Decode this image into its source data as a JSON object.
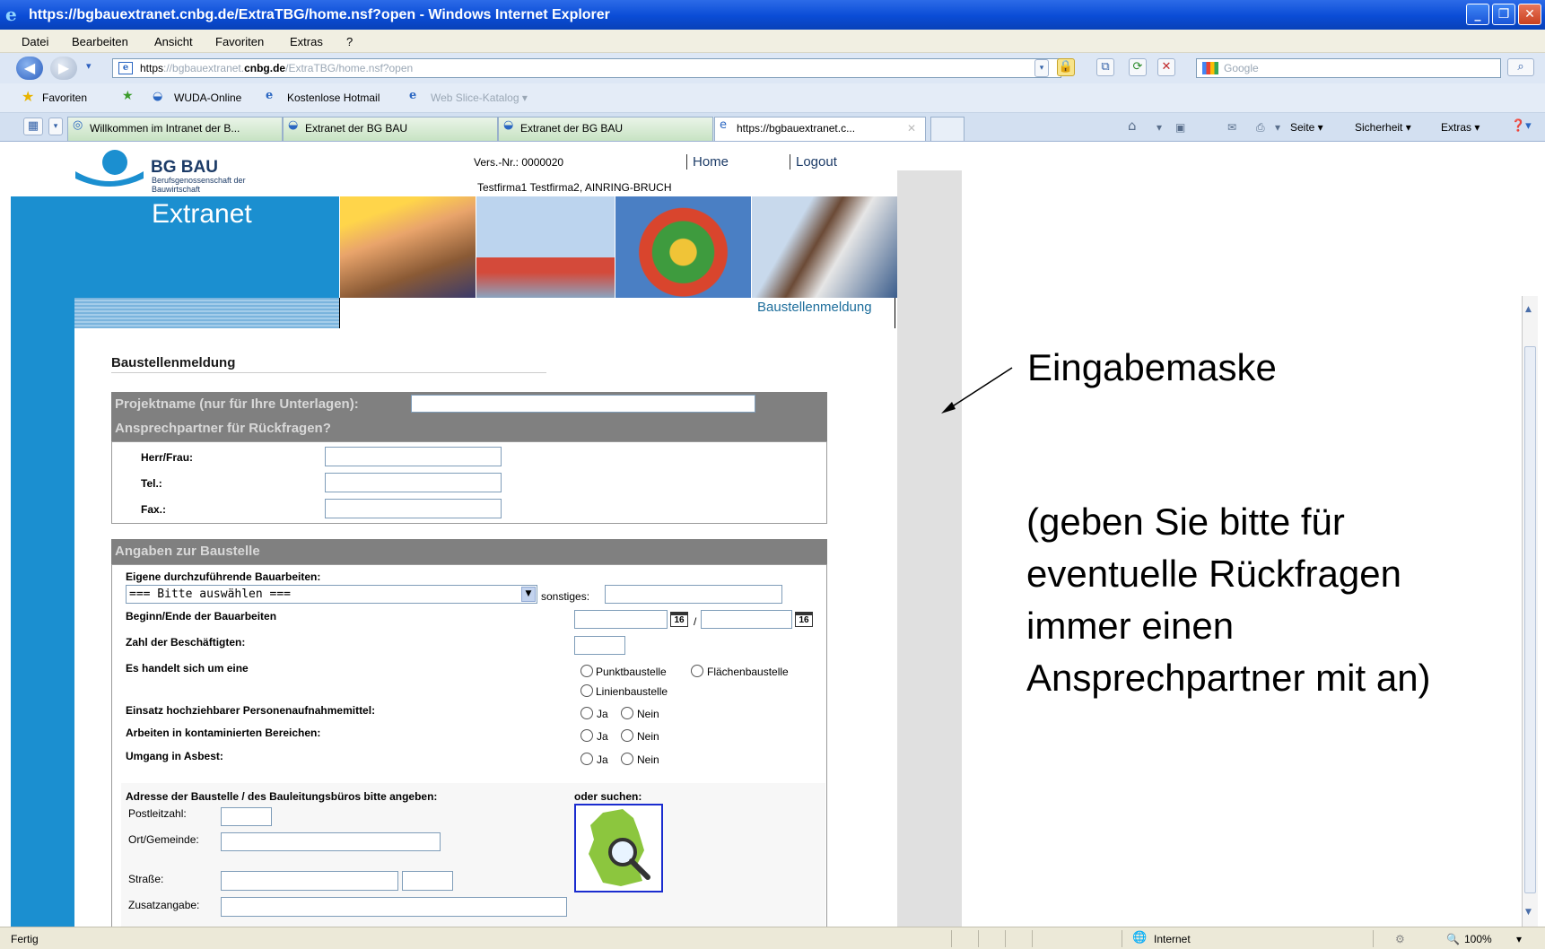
{
  "window": {
    "title": "https://bgbauextranet.cnbg.de/ExtraTBG/home.nsf?open - Windows Internet Explorer",
    "min": "_",
    "max": "❐",
    "close": "✕"
  },
  "menu": [
    "Datei",
    "Bearbeiten",
    "Ansicht",
    "Favoriten",
    "Extras",
    "?"
  ],
  "address": {
    "scheme": "https",
    "pre": "://bgbauextranet.",
    "host": "cnbg.de",
    "path": "/ExtraTBG/home.nsf?open"
  },
  "search_placeholder": "Google",
  "favorites": {
    "label": "Favoriten",
    "items": [
      "WUDA-Online",
      "Kostenlose Hotmail",
      "Web Slice-Katalog ▾"
    ]
  },
  "tabs": [
    "Willkommen im Intranet der B...",
    "Extranet der BG BAU",
    "Extranet der BG BAU",
    "https://bgbauextranet.c..."
  ],
  "commands": [
    "Seite ▾",
    "Sicherheit ▾",
    "Extras ▾"
  ],
  "page": {
    "logo_title": "BG BAU",
    "logo_sub": "Berufsgenossenschaft der Bauwirtschaft",
    "extranet": "Extranet",
    "vers_nr": "Vers.-Nr.: 0000020",
    "home": "Home",
    "logout": "Logout",
    "firm": "Testfirma1 Testfirma2, AINRING-BRUCH",
    "section_link": "Baustellenmeldung",
    "heading": "Baustellenmeldung"
  },
  "form": {
    "project_label": "Projektname (nur für Ihre Unterlagen):",
    "contact_header": "Ansprechpartner für Rückfragen?",
    "herr_frau": "Herr/Frau:",
    "tel": "Tel.:",
    "fax": "Fax.:",
    "site_header": "Angaben zur Baustelle",
    "eigene": "Eigene durchzuführende Bauarbeiten:",
    "select_value": "=== Bitte auswählen ===",
    "sonstiges": "sonstiges:",
    "beginn": "Beginn/Ende der Bauarbeiten",
    "date_sep": "/",
    "cal_label": "16",
    "zahl": "Zahl der Beschäftigten:",
    "es_handelt": "Es handelt sich um eine",
    "punkt": "Punktbaustelle",
    "flaeche": "Flächenbaustelle",
    "linie": "Linienbaustelle",
    "einsatz": "Einsatz hochziehbarer Personenaufnahmemittel:",
    "kontaminiert": "Arbeiten in kontaminierten Bereichen:",
    "asbest": "Umgang in Asbest:",
    "ja": "Ja",
    "nein": "Nein",
    "adresse": "Adresse der Baustelle / des Bauleitungsbüros bitte angeben:",
    "oder_suchen": "oder suchen:",
    "plz": "Postleitzahl:",
    "ort": "Ort/Gemeinde:",
    "strasse": "Straße:",
    "zusatz": "Zusatzangabe:"
  },
  "annotation": {
    "title": "Eingabemaske",
    "lines": [
      "(geben Sie bitte für",
      "eventuelle Rückfragen",
      "immer einen",
      "Ansprechpartner mit an)"
    ]
  },
  "status": {
    "left": "Fertig",
    "zone": "Internet",
    "zoom": "100%"
  },
  "colors": {
    "accent_blue": "#1b8fd0",
    "section_grey": "#808080",
    "title_bar": "#0a4cd6"
  }
}
